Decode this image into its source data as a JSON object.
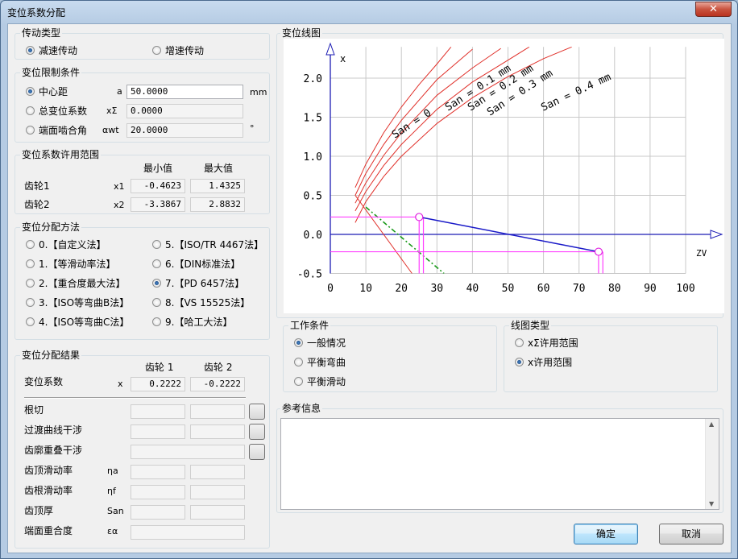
{
  "window": {
    "title": "变位系数分配",
    "close_glyph": "✕"
  },
  "drive_type": {
    "title": "传动类型",
    "options": [
      {
        "label": "减速传动",
        "selected": true
      },
      {
        "label": "增速传动",
        "selected": false
      }
    ]
  },
  "constraint": {
    "title": "变位限制条件",
    "rows": [
      {
        "label": "中心距",
        "symbol": "a",
        "value": "50.0000",
        "unit": "mm",
        "selected": true
      },
      {
        "label": "总变位系数",
        "symbol": "xΣ",
        "value": "0.0000",
        "unit": "",
        "selected": false
      },
      {
        "label": "端面啮合角",
        "symbol": "αwt",
        "value": "20.0000",
        "unit": "°",
        "selected": false
      }
    ]
  },
  "range": {
    "title": "变位系数许用范围",
    "col_min": "最小值",
    "col_max": "最大值",
    "rows": [
      {
        "label": "齿轮1",
        "symbol": "x1",
        "min": "-0.4623",
        "max": "1.4325"
      },
      {
        "label": "齿轮2",
        "symbol": "x2",
        "min": "-3.3867",
        "max": "2.8832"
      }
    ]
  },
  "method": {
    "title": "变位分配方法",
    "options": [
      {
        "label": "0.【自定义法】",
        "selected": false
      },
      {
        "label": "5.【ISO/TR 4467法】",
        "selected": false
      },
      {
        "label": "1.【等滑动率法】",
        "selected": false
      },
      {
        "label": "6.【DIN标准法】",
        "selected": false
      },
      {
        "label": "2.【重合度最大法】",
        "selected": false
      },
      {
        "label": "7.【PD 6457法】",
        "selected": true
      },
      {
        "label": "3.【ISO等弯曲B法】",
        "selected": false
      },
      {
        "label": "8.【VS 15525法】",
        "selected": false
      },
      {
        "label": "4.【ISO等弯曲C法】",
        "selected": false
      },
      {
        "label": "9.【哈工大法】",
        "selected": false
      }
    ]
  },
  "result": {
    "title": "变位分配结果",
    "col1": "齿轮 1",
    "col2": "齿轮 2",
    "coef_label": "变位系数",
    "coef_symbol": "x",
    "x1": "0.2222",
    "x2": "-0.2222",
    "rows": [
      {
        "label": "根切",
        "symbol": "",
        "btn": true,
        "wide": false
      },
      {
        "label": "过渡曲线干涉",
        "symbol": "",
        "btn": true,
        "wide": false
      },
      {
        "label": "齿廓重叠干涉",
        "symbol": "",
        "btn": true,
        "wide": true
      },
      {
        "label": "齿顶滑动率",
        "symbol": "ηa",
        "btn": false,
        "wide": false
      },
      {
        "label": "齿根滑动率",
        "symbol": "ηf",
        "btn": false,
        "wide": false
      },
      {
        "label": "齿顶厚",
        "symbol": "San",
        "btn": false,
        "wide": false
      },
      {
        "label": "端面重合度",
        "symbol": "εα",
        "btn": false,
        "wide": true
      }
    ]
  },
  "chart_section": {
    "title": "变位线图"
  },
  "chart_data": {
    "type": "line",
    "xlabel": "ZV",
    "ylabel": "x",
    "xlim": [
      0,
      100
    ],
    "ylim": [
      -0.5,
      2.0
    ],
    "x_ticks": [
      0,
      10,
      20,
      30,
      40,
      50,
      60,
      70,
      80,
      90,
      100
    ],
    "y_ticks": [
      "2.0",
      "1.5",
      "1.0",
      "0.5",
      "0.0",
      "-0.5"
    ],
    "grid": true,
    "curve_labels": [
      "San = 0",
      "San = 0.1 mm",
      "San = 0.2 mm",
      "San = 0.3 mm",
      "San = 0.4 mm"
    ],
    "red_curves": [
      {
        "name": "San = 0",
        "points": [
          [
            7,
            0.6
          ],
          [
            10,
            0.9
          ],
          [
            15,
            1.3
          ],
          [
            20,
            1.63
          ],
          [
            25,
            1.92
          ],
          [
            30,
            2.18
          ],
          [
            34,
            2.4
          ]
        ]
      },
      {
        "name": "San = 0.1 mm",
        "points": [
          [
            7,
            0.5
          ],
          [
            10,
            0.78
          ],
          [
            15,
            1.15
          ],
          [
            20,
            1.46
          ],
          [
            30,
            1.98
          ],
          [
            40,
            2.37
          ]
        ]
      },
      {
        "name": "San = 0.2 mm",
        "points": [
          [
            7,
            0.4
          ],
          [
            10,
            0.66
          ],
          [
            15,
            1.01
          ],
          [
            20,
            1.3
          ],
          [
            30,
            1.78
          ],
          [
            40,
            2.13
          ],
          [
            48,
            2.38
          ]
        ]
      },
      {
        "name": "San = 0.3 mm",
        "points": [
          [
            7,
            0.3
          ],
          [
            10,
            0.55
          ],
          [
            15,
            0.88
          ],
          [
            20,
            1.15
          ],
          [
            30,
            1.6
          ],
          [
            40,
            1.95
          ],
          [
            50,
            2.23
          ],
          [
            56,
            2.4
          ]
        ]
      },
      {
        "name": "San = 0.4 mm",
        "points": [
          [
            7,
            0.15
          ],
          [
            10,
            0.42
          ],
          [
            15,
            0.74
          ],
          [
            20,
            1.0
          ],
          [
            30,
            1.42
          ],
          [
            40,
            1.75
          ],
          [
            50,
            2.02
          ],
          [
            60,
            2.25
          ],
          [
            68,
            2.4
          ]
        ]
      }
    ],
    "red_line": {
      "points": [
        [
          7,
          0.5
        ],
        [
          23,
          -0.5
        ]
      ]
    },
    "green_dashdot": {
      "points": [
        [
          10,
          0.35
        ],
        [
          32,
          -0.5
        ]
      ]
    },
    "blue_line": {
      "points": [
        [
          25,
          0.2222
        ],
        [
          75.5,
          -0.2222
        ]
      ]
    },
    "magenta_h": [
      {
        "y": 0.2222,
        "x0": 0,
        "x1": 25
      },
      {
        "y": -0.2222,
        "x0": 0,
        "x1": 75.5
      }
    ],
    "magenta_v": [
      {
        "x": 25,
        "y0": 0.2222,
        "y1": -0.5
      },
      {
        "x": 26.2,
        "y0": 0.2222,
        "y1": -0.5
      },
      {
        "x": 75.5,
        "y0": -0.2222,
        "y1": -0.5
      },
      {
        "x": 76.7,
        "y0": -0.2222,
        "y1": -0.5
      }
    ],
    "markers": [
      [
        25,
        0.2222
      ],
      [
        75.5,
        -0.2222
      ]
    ]
  },
  "work": {
    "title": "工作条件",
    "options": [
      {
        "label": "一般情况",
        "selected": true
      },
      {
        "label": "平衡弯曲",
        "selected": false
      },
      {
        "label": "平衡滑动",
        "selected": false
      }
    ]
  },
  "linetype": {
    "title": "线图类型",
    "options": [
      {
        "label": "xΣ许用范围",
        "selected": false
      },
      {
        "label": "x许用范围",
        "selected": true
      }
    ]
  },
  "info": {
    "title": "参考信息",
    "text": ""
  },
  "buttons": {
    "ok": "确定",
    "cancel": "取消"
  }
}
